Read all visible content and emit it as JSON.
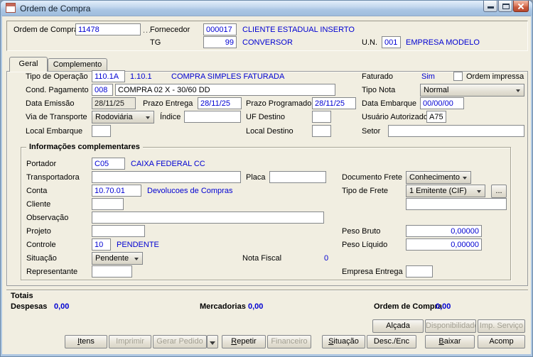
{
  "window": {
    "title": "Ordem de Compra"
  },
  "colors": {
    "value_text": "#0000d2",
    "client_bg": "#f1eee1",
    "titlebar": "#b7cfe8",
    "close_button": "#c95a3e"
  },
  "icons": {
    "window": "document-icon",
    "minimize": "minimize-icon",
    "maximize": "maximize-icon",
    "close": "close-icon",
    "combo_arrow": "chevron-down-icon",
    "gerar_pedido_split": "chevron-down-icon",
    "lookup": "ellipsis-icon"
  },
  "header": {
    "ordem": {
      "label": "Ordem de Compra",
      "value": "11478",
      "lookup": "..."
    },
    "fornecedor": {
      "label": "Fornecedor",
      "code": "000017",
      "desc": "CLIENTE ESTADUAL INSERTO"
    },
    "tg": {
      "label": "TG",
      "code": "99",
      "desc": "CONVERSOR"
    },
    "un": {
      "label": "U.N.",
      "code": "001",
      "desc": "EMPRESA MODELO"
    }
  },
  "tabs": [
    {
      "label": "Geral",
      "active": true
    },
    {
      "label": "Complemento",
      "active": false
    }
  ],
  "geral": {
    "tipo_operacao": {
      "label": "Tipo de Operação",
      "code": "110.1A",
      "code2": "1.10.1",
      "desc": "COMPRA SIMPLES FATURADA"
    },
    "faturado": {
      "label": "Faturado",
      "value": "Sim"
    },
    "ordem_impressa": {
      "label": "Ordem impressa",
      "checked": false
    },
    "cond_pagamento": {
      "label": "Cond. Pagamento",
      "code": "008",
      "desc": "COMPRA 02 X - 30/60 DD"
    },
    "tipo_nota": {
      "label": "Tipo Nota",
      "value": "Normal"
    },
    "data_emissao": {
      "label": "Data Emissão",
      "value": "28/11/25"
    },
    "prazo_entrega": {
      "label": "Prazo Entrega",
      "value": "28/11/25"
    },
    "prazo_programado": {
      "label": "Prazo Programado",
      "value": "28/11/25"
    },
    "data_embarque": {
      "label": "Data Embarque",
      "value": "00/00/00"
    },
    "via_transporte": {
      "label": "Via de Transporte",
      "value": "Rodoviária"
    },
    "indice": {
      "label": "Índice",
      "value": ""
    },
    "uf_destino": {
      "label": "UF Destino",
      "value": ""
    },
    "usuario_autorizado": {
      "label": "Usuário Autorizado",
      "value": "A75"
    },
    "local_embarque": {
      "label": "Local Embarque",
      "value": ""
    },
    "local_destino": {
      "label": "Local Destino",
      "value": ""
    },
    "setor": {
      "label": "Setor",
      "value": ""
    }
  },
  "complementares": {
    "title": "Informações complementares",
    "portador": {
      "label": "Portador",
      "code": "C05",
      "desc": "CAIXA FEDERAL CC"
    },
    "transportadora": {
      "label": "Transportadora",
      "value": ""
    },
    "placa": {
      "label": "Placa",
      "value": ""
    },
    "documento_frete": {
      "label": "Documento Frete",
      "value": "Conhecimento"
    },
    "conta": {
      "label": "Conta",
      "code": "10.70.01",
      "desc": "Devolucoes de Compras"
    },
    "tipo_frete": {
      "label": "Tipo de Frete",
      "value": "1 Emitente (CIF)",
      "lookup": "...",
      "desc": ""
    },
    "cliente": {
      "label": "Cliente",
      "value": ""
    },
    "observacao": {
      "label": "Observação",
      "value": ""
    },
    "projeto": {
      "label": "Projeto",
      "value": ""
    },
    "peso_bruto": {
      "label": "Peso Bruto",
      "value": "0,00000"
    },
    "controle": {
      "label": "Controle",
      "code": "10",
      "desc": "PENDENTE"
    },
    "peso_liquido": {
      "label": "Peso Líquido",
      "value": "0,00000"
    },
    "situacao": {
      "label": "Situação",
      "value": "Pendente"
    },
    "nota_fiscal": {
      "label": "Nota Fiscal",
      "value": "0"
    },
    "representante": {
      "label": "Representante",
      "value": ""
    },
    "empresa_entrega": {
      "label": "Empresa Entrega",
      "value": ""
    }
  },
  "totais": {
    "title": "Totais",
    "despesas": {
      "label": "Despesas",
      "value": "0,00"
    },
    "mercadorias": {
      "label": "Mercadorias",
      "value": "0,00"
    },
    "ordem_compra": {
      "label": "Ordem de Compra",
      "value": "0,00"
    }
  },
  "actions": {
    "row_top": [
      {
        "label": "Alçada",
        "enabled": true
      },
      {
        "label": "Disponibilidade",
        "enabled": false
      },
      {
        "label": "Imp. Serviço",
        "enabled": false
      }
    ],
    "row_bottom": [
      {
        "label": "Itens",
        "enabled": true
      },
      {
        "label": "Imprimir",
        "enabled": false
      },
      {
        "label": "Gerar Pedido",
        "enabled": false
      },
      {
        "label": "Repetir",
        "enabled": true
      },
      {
        "label": "Financeiro",
        "enabled": false
      },
      {
        "label": "Situação",
        "enabled": true
      },
      {
        "label": "Desc./Enc",
        "enabled": true
      },
      {
        "label": "Baixar",
        "enabled": true
      },
      {
        "label": "Acomp",
        "enabled": true
      }
    ]
  }
}
